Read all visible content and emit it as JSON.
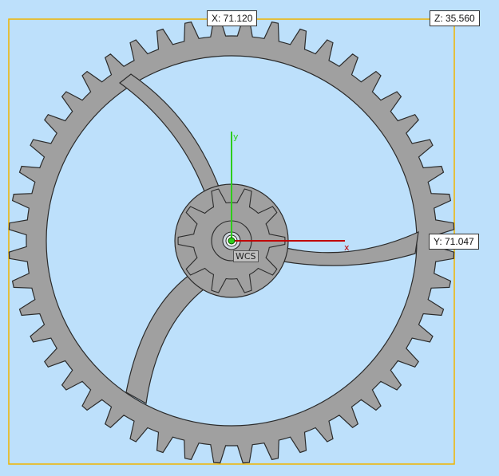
{
  "viewport": {
    "background_color": "#bde0fb",
    "bounding_box_color": "#f0b400",
    "part_fill_color": "#a0a0a0",
    "part_stroke_color": "#2b2b2b"
  },
  "dimensions": {
    "x_label": "X: 71.120",
    "y_label": "Y: 71.047",
    "z_label": "Z: 35.560"
  },
  "coordinate_system": {
    "name": "WCS",
    "x_axis_label": "x",
    "y_axis_label": "y",
    "x_axis_color": "#c00000",
    "y_axis_color": "#2ecc1a"
  },
  "model": {
    "outer_gear_teeth": 48,
    "inner_pinion_teeth": 10,
    "spokes": 3
  }
}
